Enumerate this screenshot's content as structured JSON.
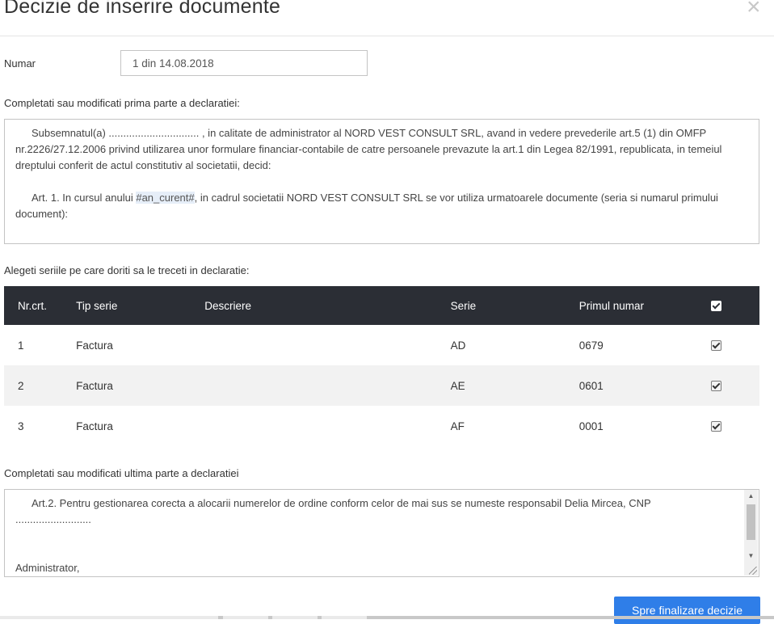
{
  "modal": {
    "title": "Decizie de inserire documente",
    "close_glyph": "×"
  },
  "numar": {
    "label": "Numar",
    "value": "1 din 14.08.2018"
  },
  "first_part": {
    "label": "Completati sau modificati prima parte a declaratiei:",
    "paragraph1": "Subsemnatul(a) ............................... , in calitate de administrator al NORD VEST CONSULT SRL, avand in vedere prevederile art.5 (1) din OMFP nr.2226/27.12.2006 privind utilizarea unor formulare financiar-contabile de catre persoanele prevazute la art.1 din Legea 82/1991, republicata, in temeiul dreptului conferit de actul constitutiv al societatii, decid:",
    "paragraph2_before": "Art. 1. In cursul anului ",
    "paragraph2_highlight": "#an_curent#",
    "paragraph2_after": ", in cadrul societatii NORD VEST CONSULT SRL se vor utiliza urmatoarele documente (seria si numarul primului document):"
  },
  "series": {
    "label": "Alegeti seriile pe care doriti sa le treceti in declaratie:",
    "columns": [
      "Nr.crt.",
      "Tip serie",
      "Descriere",
      "Serie",
      "Primul numar"
    ],
    "rows": [
      {
        "nr": "1",
        "tip": "Factura",
        "descriere": "",
        "serie": "AD",
        "primul": "0679",
        "checked": true
      },
      {
        "nr": "2",
        "tip": "Factura",
        "descriere": "",
        "serie": "AE",
        "primul": "0601",
        "checked": true
      },
      {
        "nr": "3",
        "tip": "Factura",
        "descriere": "",
        "serie": "AF",
        "primul": "0001",
        "checked": true
      }
    ]
  },
  "last_part": {
    "label": "Completati sau modificati ultima parte a declaratiei",
    "line1": "Art.2. Pentru gestionarea corecta a alocarii numerelor de ordine conform celor de mai sus se numeste responsabil Delia Mircea, CNP",
    "line2": "..........................",
    "line3": "Administrator,"
  },
  "footer": {
    "finalize_label": "Spre finalizare decizie"
  },
  "colors": {
    "table_header_bg": "#2b2e35",
    "primary_button": "#2f7ee8",
    "alt_row_bg": "#f2f2f2"
  }
}
